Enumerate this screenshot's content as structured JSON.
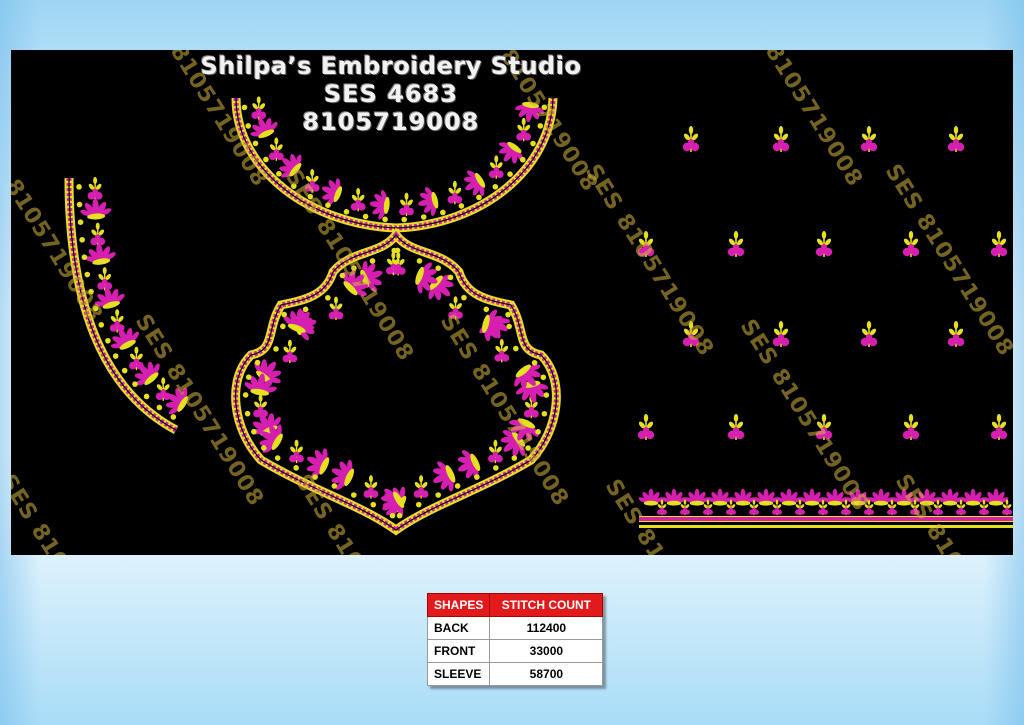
{
  "studio": {
    "name": "Shilpa’s Embroidery Studio",
    "design_code": "SES  4683",
    "phone": "8105719008"
  },
  "watermark": {
    "text_a": "SES 8105719008",
    "text_b": "8105719008"
  },
  "colors": {
    "panel": "#000000",
    "flower_pink": "#d61fb0",
    "thread_yellow": "#e6e01f",
    "table_header": "#e31a1c"
  },
  "table": {
    "headers": [
      "SHAPES",
      "STITCH COUNT"
    ],
    "rows": [
      {
        "shape": "BACK",
        "count": "112400"
      },
      {
        "shape": "FRONT",
        "count": "33000"
      },
      {
        "shape": "SLEEVE",
        "count": "58700"
      }
    ]
  }
}
